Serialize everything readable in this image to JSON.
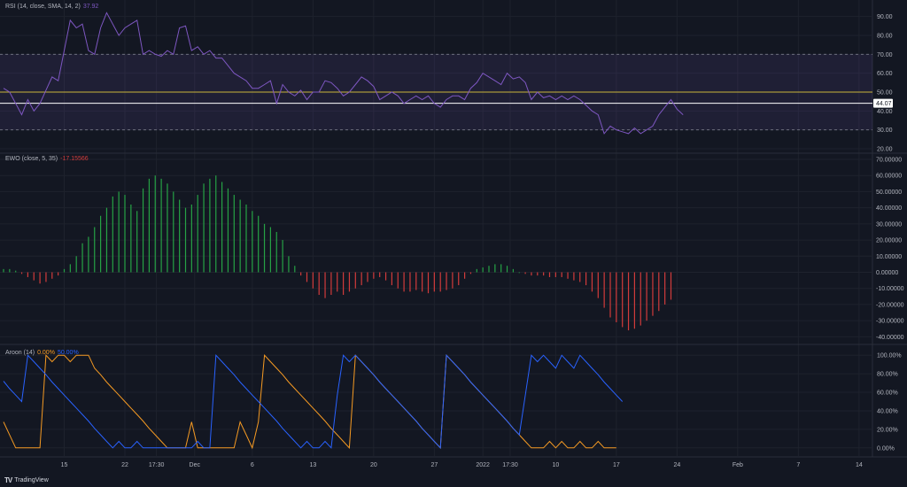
{
  "app": {
    "logo_mark": "TV",
    "logo_text": "TradingView"
  },
  "colors": {
    "background": "#131722",
    "grid": "#1e222d",
    "text": "#b2b5be",
    "rsi": "#7e57c2",
    "rsi_band": "#7e57c2",
    "rsi_ma": "#c9b43a",
    "ewo_up": "#26a245",
    "ewo_down": "#d13b3b",
    "aroon_up": "#f59a23",
    "aroon_down": "#2962ff"
  },
  "x_axis": {
    "tick_labels": [
      "15",
      "22",
      "17:30",
      "Dec",
      "6",
      "13",
      "20",
      "27",
      "2022",
      "17:30",
      "10",
      "17",
      "24",
      "Feb",
      "7",
      "14"
    ],
    "tick_bar": [
      10,
      20,
      25.2,
      31.5,
      41,
      51,
      61,
      71,
      79,
      83.5,
      91,
      101,
      111,
      121,
      131,
      141
    ]
  },
  "chart_data": [
    {
      "type": "line",
      "name": "rsi",
      "legend": {
        "label": "RSI (14, close, SMA, 14, 2)",
        "value": "37.92"
      },
      "ylim": [
        20,
        95
      ],
      "y_ticks": [
        "90.00",
        "80.00",
        "70.00",
        "60.00",
        "50.00",
        "40.00",
        "30.00",
        "20.00"
      ],
      "band": [
        30,
        70
      ],
      "ma_level": 50,
      "last_value": 44.07,
      "last_label": "44.07",
      "values": [
        52,
        50,
        44,
        38,
        46,
        40,
        44,
        51,
        58,
        56,
        72,
        88,
        84,
        86,
        72,
        70,
        84,
        92,
        86,
        80,
        84,
        86,
        88,
        70,
        72,
        70,
        69,
        72,
        70,
        84,
        85,
        72,
        74,
        70,
        72,
        68,
        68,
        64,
        60,
        58,
        56,
        52,
        52,
        54,
        56,
        44,
        54,
        50,
        48,
        51,
        46,
        50,
        50,
        56,
        55,
        52,
        48,
        50,
        54,
        58,
        56,
        53,
        46,
        48,
        50,
        48,
        44,
        46,
        48,
        46,
        48,
        44,
        42,
        46,
        48,
        48,
        46,
        52,
        55,
        60,
        58,
        56,
        54,
        60,
        57,
        58,
        55,
        46,
        50,
        47,
        48,
        46,
        48,
        46,
        48,
        46,
        43,
        40,
        38,
        28,
        32,
        30,
        29,
        28,
        31,
        28,
        30,
        32,
        38,
        42,
        46,
        41,
        38
      ]
    },
    {
      "type": "bar",
      "name": "ewo",
      "legend": {
        "label": "EWO (close, 5, 35)",
        "value": "-17.15566"
      },
      "ylim": [
        -42,
        70
      ],
      "y_ticks": [
        "70.00000",
        "60.00000",
        "50.00000",
        "40.00000",
        "30.00000",
        "20.00000",
        "10.00000",
        "0.00000",
        "-10.00000",
        "-20.00000",
        "-30.00000",
        "-40.00000"
      ],
      "values": [
        2,
        2,
        1,
        -1,
        -3,
        -5,
        -7,
        -6,
        -4,
        -2,
        2,
        5,
        10,
        18,
        22,
        28,
        35,
        40,
        47,
        50,
        48,
        42,
        38,
        52,
        58,
        60,
        58,
        55,
        50,
        45,
        40,
        42,
        48,
        55,
        58,
        60,
        56,
        52,
        48,
        45,
        42,
        38,
        35,
        30,
        28,
        25,
        20,
        10,
        4,
        -2,
        -6,
        -10,
        -14,
        -16,
        -14,
        -12,
        -14,
        -12,
        -10,
        -8,
        -6,
        -4,
        -3,
        -5,
        -8,
        -10,
        -12,
        -12,
        -11,
        -12,
        -13,
        -12,
        -12,
        -11,
        -10,
        -8,
        -4,
        -1,
        2,
        3,
        4,
        5,
        5,
        4,
        2,
        0,
        -1,
        -2,
        -2,
        -2,
        -3,
        -3,
        -3,
        -4,
        -5,
        -6,
        -8,
        -12,
        -16,
        -22,
        -28,
        -31,
        -34,
        -36,
        -35,
        -33,
        -30,
        -27,
        -24,
        -20,
        -17
      ]
    },
    {
      "type": "line",
      "name": "aroon",
      "legend": {
        "label": "Aroon (14)",
        "values": [
          "0.00%",
          "50.00%"
        ]
      },
      "ylim": [
        -5,
        105
      ],
      "y_ticks": [
        "100.00%",
        "80.00%",
        "60.00%",
        "40.00%",
        "20.00%",
        "0.00%"
      ],
      "series": [
        {
          "name": "0.00%",
          "color": "#f59a23",
          "values": [
            28,
            14,
            0,
            0,
            0,
            0,
            0,
            100,
            93,
            100,
            100,
            93,
            100,
            100,
            100,
            86,
            79,
            71,
            64,
            57,
            50,
            43,
            36,
            29,
            21,
            14,
            7,
            0,
            0,
            0,
            0,
            28,
            0,
            0,
            0,
            0,
            0,
            0,
            0,
            28,
            14,
            0,
            28,
            100,
            93,
            86,
            79,
            71,
            64,
            57,
            50,
            43,
            36,
            29,
            21,
            14,
            7,
            0,
            100,
            93,
            86,
            79,
            71,
            64,
            57,
            50,
            43,
            36,
            29,
            21,
            14,
            7,
            0,
            100,
            93,
            86,
            79,
            71,
            64,
            57,
            50,
            43,
            36,
            29,
            21,
            14,
            7,
            0,
            0,
            0,
            7,
            0,
            7,
            0,
            0,
            7,
            0,
            0,
            7,
            0,
            0,
            0
          ]
        },
        {
          "name": "50.00%",
          "color": "#2962ff",
          "values": [
            72,
            64,
            57,
            50,
            100,
            93,
            86,
            79,
            71,
            64,
            57,
            50,
            43,
            36,
            29,
            21,
            14,
            7,
            0,
            7,
            0,
            0,
            7,
            0,
            0,
            0,
            0,
            0,
            0,
            0,
            0,
            0,
            7,
            0,
            0,
            100,
            93,
            86,
            79,
            71,
            64,
            57,
            50,
            43,
            36,
            29,
            21,
            14,
            7,
            0,
            7,
            0,
            0,
            7,
            0,
            57,
            100,
            93,
            100,
            93,
            86,
            79,
            71,
            64,
            57,
            50,
            43,
            36,
            29,
            21,
            14,
            7,
            0,
            100,
            93,
            86,
            79,
            71,
            64,
            57,
            50,
            43,
            36,
            29,
            21,
            14,
            57,
            100,
            93,
            100,
            93,
            86,
            100,
            93,
            86,
            100,
            93,
            86,
            79,
            71,
            64,
            57,
            50
          ]
        }
      ]
    }
  ]
}
